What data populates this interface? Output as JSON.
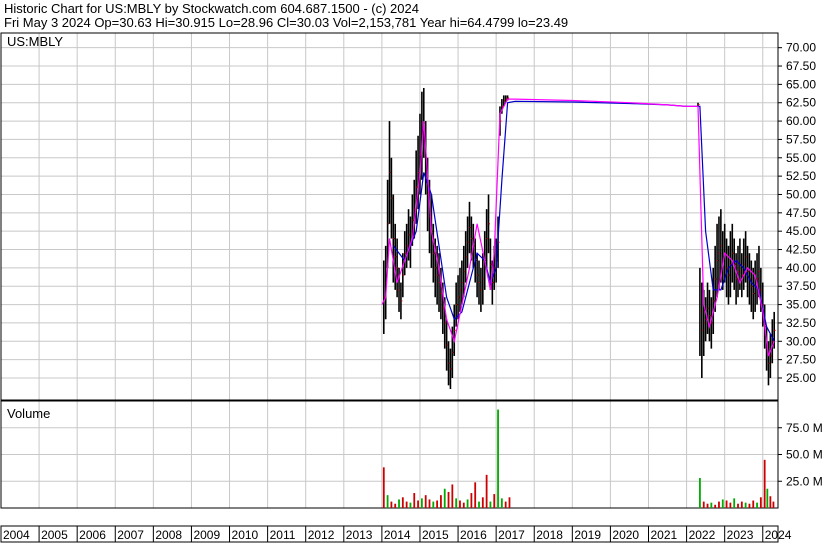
{
  "header": {
    "line1": "Historic Chart for US:MBLY by Stockwatch.com 604.687.1500 - (c) 2024",
    "line2": "Fri May  3 2024   Op=30.63   Hi=30.915   Lo=28.96   Cl=30.03   Vol=2,153,781   Year hi=64.4799   lo=23.49"
  },
  "chart_data": {
    "type": "line",
    "ticker_label": "US:MBLY",
    "volume_label": "Volume",
    "colors": {
      "price_bar": "#000000",
      "price_close": "#cc0000",
      "ma_short": "#ff00ff",
      "ma_long": "#0000cc",
      "volume_up": "#00aa00",
      "volume_down": "#cc0000",
      "grid": "#c8c8c8"
    },
    "x_axis": {
      "years": [
        "2004",
        "2005",
        "2006",
        "2007",
        "2008",
        "2009",
        "2010",
        "2011",
        "2012",
        "2013",
        "2014",
        "2015",
        "2016",
        "2017",
        "2018",
        "2019",
        "2020",
        "2021",
        "2022",
        "2023",
        "2024"
      ],
      "range": [
        2004.0,
        2024.4
      ]
    },
    "price_axis": {
      "ylim": [
        22.0,
        72.0
      ],
      "ticks": [
        "25.00",
        "27.50",
        "30.00",
        "32.50",
        "35.00",
        "37.50",
        "40.00",
        "42.50",
        "45.00",
        "47.50",
        "50.00",
        "52.50",
        "55.00",
        "57.50",
        "60.00",
        "62.50",
        "65.00",
        "67.50",
        "70.00"
      ]
    },
    "volume_axis": {
      "ylim": [
        0,
        100
      ],
      "unit": "M",
      "ticks": [
        "25.0 M",
        "50.0 M",
        "75.0 M"
      ]
    },
    "ma_short": [
      [
        2014.0,
        35
      ],
      [
        2014.1,
        36
      ],
      [
        2014.2,
        44
      ],
      [
        2014.4,
        38
      ],
      [
        2014.6,
        41
      ],
      [
        2014.8,
        44
      ],
      [
        2015.0,
        53
      ],
      [
        2015.1,
        60
      ],
      [
        2015.3,
        45
      ],
      [
        2015.5,
        40
      ],
      [
        2015.7,
        33
      ],
      [
        2015.9,
        30
      ],
      [
        2016.1,
        35
      ],
      [
        2016.3,
        40
      ],
      [
        2016.5,
        46
      ],
      [
        2016.7,
        41
      ],
      [
        2016.85,
        37
      ],
      [
        2016.95,
        42
      ],
      [
        2017.1,
        61
      ],
      [
        2017.3,
        63
      ],
      [
        2017.5,
        63
      ],
      [
        2019.0,
        62.8
      ],
      [
        2020.5,
        62.5
      ],
      [
        2021.5,
        62.2
      ],
      [
        2022.0,
        62.0
      ],
      [
        2022.3,
        62.0
      ],
      [
        2022.45,
        35
      ],
      [
        2022.6,
        32
      ],
      [
        2022.8,
        36
      ],
      [
        2023.0,
        42
      ],
      [
        2023.2,
        41
      ],
      [
        2023.4,
        38
      ],
      [
        2023.6,
        40
      ],
      [
        2023.8,
        39
      ],
      [
        2024.0,
        34
      ],
      [
        2024.15,
        28
      ],
      [
        2024.3,
        30
      ]
    ],
    "ma_long": [
      [
        2014.3,
        43
      ],
      [
        2014.6,
        41
      ],
      [
        2014.9,
        45
      ],
      [
        2015.1,
        53
      ],
      [
        2015.3,
        50
      ],
      [
        2015.5,
        43
      ],
      [
        2015.7,
        36
      ],
      [
        2015.9,
        33
      ],
      [
        2016.1,
        34
      ],
      [
        2016.3,
        38
      ],
      [
        2016.5,
        42
      ],
      [
        2016.7,
        41
      ],
      [
        2016.85,
        38
      ],
      [
        2017.0,
        40
      ],
      [
        2017.15,
        52
      ],
      [
        2017.3,
        62.5
      ],
      [
        2017.5,
        62.7
      ],
      [
        2019.0,
        62.6
      ],
      [
        2020.5,
        62.4
      ],
      [
        2021.5,
        62.2
      ],
      [
        2022.0,
        62.0
      ],
      [
        2022.35,
        62.0
      ],
      [
        2022.5,
        45
      ],
      [
        2022.7,
        37
      ],
      [
        2022.9,
        37
      ],
      [
        2023.1,
        40
      ],
      [
        2023.3,
        41
      ],
      [
        2023.5,
        40
      ],
      [
        2023.7,
        38
      ],
      [
        2023.9,
        37
      ],
      [
        2024.1,
        32
      ],
      [
        2024.3,
        30
      ]
    ],
    "price_ranges": [
      [
        2014.05,
        31,
        41
      ],
      [
        2014.1,
        33,
        43
      ],
      [
        2014.15,
        40,
        52
      ],
      [
        2014.2,
        46,
        60
      ],
      [
        2014.25,
        44,
        55
      ],
      [
        2014.3,
        38,
        50
      ],
      [
        2014.35,
        37,
        46
      ],
      [
        2014.4,
        36,
        44
      ],
      [
        2014.45,
        34,
        40
      ],
      [
        2014.5,
        33,
        38
      ],
      [
        2014.55,
        36,
        42
      ],
      [
        2014.6,
        39,
        45
      ],
      [
        2014.65,
        40,
        46
      ],
      [
        2014.7,
        41,
        48
      ],
      [
        2014.75,
        40,
        47
      ],
      [
        2014.8,
        43,
        50
      ],
      [
        2014.85,
        44,
        52
      ],
      [
        2014.9,
        46,
        56
      ],
      [
        2014.95,
        48,
        58
      ],
      [
        2015.0,
        50,
        61
      ],
      [
        2015.05,
        52,
        64
      ],
      [
        2015.1,
        55,
        64.5
      ],
      [
        2015.15,
        50,
        60
      ],
      [
        2015.2,
        45,
        55
      ],
      [
        2015.25,
        42,
        52
      ],
      [
        2015.3,
        40,
        50
      ],
      [
        2015.35,
        38,
        46
      ],
      [
        2015.4,
        36,
        44
      ],
      [
        2015.45,
        35,
        43
      ],
      [
        2015.5,
        34,
        42
      ],
      [
        2015.55,
        33,
        40
      ],
      [
        2015.6,
        31,
        38
      ],
      [
        2015.65,
        29,
        36
      ],
      [
        2015.7,
        26,
        33
      ],
      [
        2015.75,
        24,
        30
      ],
      [
        2015.8,
        23.5,
        29
      ],
      [
        2015.85,
        25,
        32
      ],
      [
        2015.9,
        28,
        35
      ],
      [
        2015.95,
        32,
        38
      ],
      [
        2016.0,
        33,
        39
      ],
      [
        2016.05,
        34,
        40
      ],
      [
        2016.1,
        35,
        41
      ],
      [
        2016.15,
        36,
        43
      ],
      [
        2016.2,
        38,
        45
      ],
      [
        2016.25,
        40,
        47
      ],
      [
        2016.3,
        42,
        49
      ],
      [
        2016.35,
        41,
        47
      ],
      [
        2016.4,
        40,
        46
      ],
      [
        2016.45,
        38,
        44
      ],
      [
        2016.5,
        36,
        42
      ],
      [
        2016.55,
        35,
        41
      ],
      [
        2016.6,
        34,
        40
      ],
      [
        2016.65,
        35,
        42
      ],
      [
        2016.7,
        37,
        45
      ],
      [
        2016.75,
        40,
        48
      ],
      [
        2016.8,
        42,
        50
      ],
      [
        2016.85,
        37,
        44
      ],
      [
        2016.9,
        35,
        41
      ],
      [
        2016.95,
        37,
        43
      ],
      [
        2017.0,
        38,
        44
      ],
      [
        2017.05,
        40,
        47
      ],
      [
        2017.1,
        58,
        62
      ],
      [
        2017.15,
        61,
        63
      ],
      [
        2017.2,
        62,
        63.5
      ],
      [
        2017.25,
        62.5,
        63.5
      ],
      [
        2017.3,
        62.8,
        63.5
      ],
      [
        2022.3,
        62,
        62.5
      ],
      [
        2022.35,
        28,
        40
      ],
      [
        2022.4,
        25,
        38
      ],
      [
        2022.45,
        28,
        37
      ],
      [
        2022.5,
        30,
        36
      ],
      [
        2022.55,
        31,
        38
      ],
      [
        2022.6,
        30,
        37
      ],
      [
        2022.65,
        29,
        36
      ],
      [
        2022.7,
        31,
        40
      ],
      [
        2022.75,
        34,
        43
      ],
      [
        2022.8,
        36,
        46
      ],
      [
        2022.85,
        37,
        47
      ],
      [
        2022.9,
        38,
        48
      ],
      [
        2022.95,
        37,
        45
      ],
      [
        2023.0,
        38,
        46
      ],
      [
        2023.05,
        36,
        44
      ],
      [
        2023.1,
        35,
        43
      ],
      [
        2023.15,
        36,
        45
      ],
      [
        2023.2,
        38,
        46
      ],
      [
        2023.25,
        37,
        44
      ],
      [
        2023.3,
        35,
        42
      ],
      [
        2023.35,
        36,
        43
      ],
      [
        2023.4,
        37,
        44
      ],
      [
        2023.45,
        36,
        42
      ],
      [
        2023.5,
        37,
        44
      ],
      [
        2023.55,
        38,
        45
      ],
      [
        2023.6,
        36,
        43
      ],
      [
        2023.65,
        35,
        42
      ],
      [
        2023.7,
        34,
        41
      ],
      [
        2023.75,
        33,
        40
      ],
      [
        2023.8,
        34,
        41
      ],
      [
        2023.85,
        35,
        42
      ],
      [
        2023.9,
        36,
        43
      ],
      [
        2023.95,
        34,
        40
      ],
      [
        2024.0,
        32,
        38
      ],
      [
        2024.05,
        29,
        35
      ],
      [
        2024.1,
        26,
        32
      ],
      [
        2024.15,
        24,
        30
      ],
      [
        2024.2,
        25,
        31
      ],
      [
        2024.25,
        27,
        33
      ],
      [
        2024.3,
        29,
        34
      ]
    ],
    "volume": [
      [
        2014.05,
        38
      ],
      [
        2014.15,
        12
      ],
      [
        2014.25,
        6
      ],
      [
        2014.35,
        4
      ],
      [
        2014.45,
        8
      ],
      [
        2014.55,
        10
      ],
      [
        2014.65,
        6
      ],
      [
        2014.75,
        5
      ],
      [
        2014.85,
        14
      ],
      [
        2014.95,
        7
      ],
      [
        2015.05,
        9
      ],
      [
        2015.15,
        12
      ],
      [
        2015.25,
        8
      ],
      [
        2015.35,
        6
      ],
      [
        2015.45,
        7
      ],
      [
        2015.55,
        12
      ],
      [
        2015.65,
        18
      ],
      [
        2015.75,
        15
      ],
      [
        2015.85,
        22
      ],
      [
        2015.95,
        9
      ],
      [
        2016.05,
        7
      ],
      [
        2016.15,
        5
      ],
      [
        2016.25,
        8
      ],
      [
        2016.35,
        14
      ],
      [
        2016.45,
        24
      ],
      [
        2016.55,
        6
      ],
      [
        2016.65,
        10
      ],
      [
        2016.75,
        31
      ],
      [
        2016.85,
        6
      ],
      [
        2016.95,
        13
      ],
      [
        2017.05,
        92
      ],
      [
        2017.15,
        9
      ],
      [
        2017.25,
        6
      ],
      [
        2017.35,
        10
      ],
      [
        2022.35,
        28
      ],
      [
        2022.45,
        6
      ],
      [
        2022.55,
        4
      ],
      [
        2022.65,
        5
      ],
      [
        2022.75,
        3
      ],
      [
        2022.85,
        6
      ],
      [
        2022.95,
        8
      ],
      [
        2023.05,
        7
      ],
      [
        2023.15,
        5
      ],
      [
        2023.25,
        9
      ],
      [
        2023.35,
        4
      ],
      [
        2023.45,
        6
      ],
      [
        2023.55,
        5
      ],
      [
        2023.65,
        4
      ],
      [
        2023.75,
        7
      ],
      [
        2023.85,
        5
      ],
      [
        2023.95,
        10
      ],
      [
        2024.05,
        45
      ],
      [
        2024.12,
        18
      ],
      [
        2024.2,
        11
      ],
      [
        2024.28,
        6
      ]
    ]
  }
}
